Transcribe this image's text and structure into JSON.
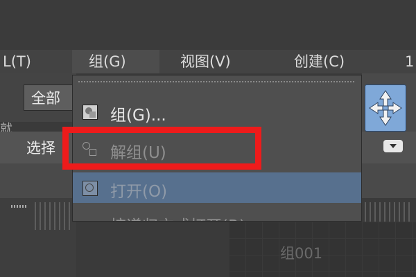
{
  "menubar": {
    "items": [
      {
        "label": "L(T)"
      },
      {
        "label": "组(G)"
      },
      {
        "label": "视图(V)"
      },
      {
        "label": "创建(C)"
      },
      {
        "label": "1"
      }
    ]
  },
  "toolbar": {
    "filter_value": "全部",
    "left_fragment": "就",
    "selection_label": "选择"
  },
  "group_menu": {
    "items": [
      {
        "label": "组(G)...",
        "enabled": true,
        "icon": "group-icon"
      },
      {
        "label": "解组(U)",
        "enabled": false,
        "icon": "ungroup-icon"
      },
      {
        "label": "打开(O)",
        "enabled": false,
        "icon": "open-group-icon"
      },
      {
        "label": "按递归方式打开(R)",
        "enabled": false
      }
    ]
  },
  "viewport": {
    "object_label": "组001"
  },
  "colors": {
    "menu_text": "#dcdcdc",
    "disabled_text": "#8f8f8f",
    "highlight": "#57708e",
    "annotation": "#ee1b1b",
    "move_button": "#7fa8d8"
  }
}
